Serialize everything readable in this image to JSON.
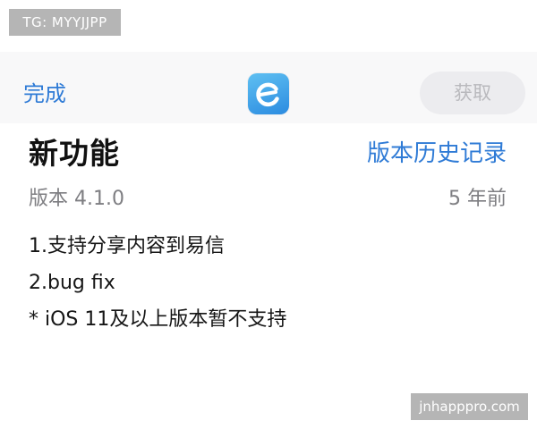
{
  "watermark": {
    "top_left": "TG: MYYJJPP",
    "bottom_right": "jnhapppro.com"
  },
  "nav": {
    "done_label": "完成",
    "get_label": "获取",
    "app_icon": "app-logo-icon"
  },
  "whats_new": {
    "title": "新功能",
    "history_label": "版本历史记录",
    "version": "版本 4.1.0",
    "time_ago": "5 年前",
    "notes": [
      "1.支持分享内容到易信",
      "2.bug fix",
      "* iOS 11及以上版本暂不支持"
    ]
  },
  "colors": {
    "link_blue": "#2f7bd6",
    "icon_gradient_start": "#5fc0f2",
    "icon_gradient_end": "#2b8be0",
    "button_bg": "#ececef",
    "button_text": "#b9b9bd"
  }
}
